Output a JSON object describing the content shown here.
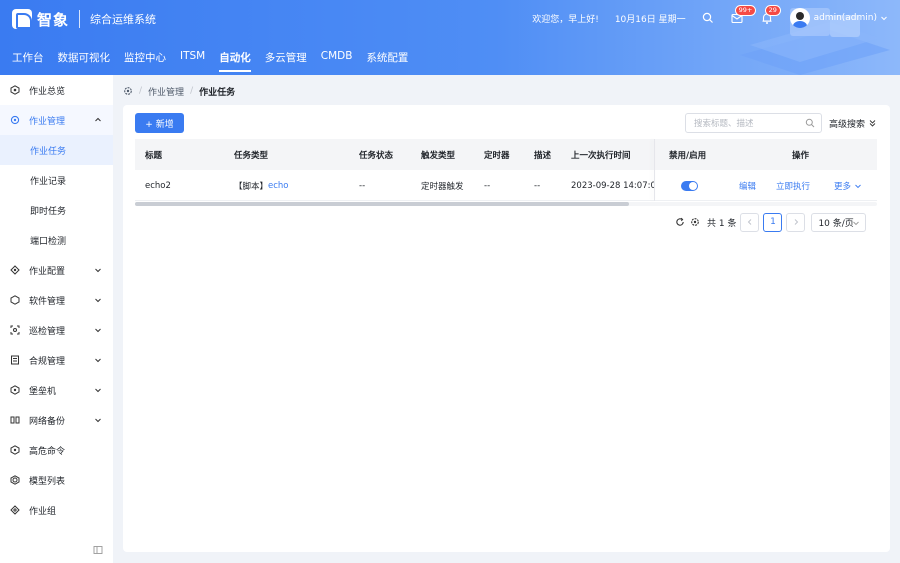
{
  "header": {
    "brand": "智象",
    "system_name": "综合运维系统",
    "greeting": "欢迎您，早上好!",
    "date": "10月16日 星期一",
    "mail_badge": "99+",
    "bell_badge": "29",
    "user": "admin(admin)"
  },
  "nav": {
    "items": [
      "工作台",
      "数据可视化",
      "监控中心",
      "ITSM",
      "自动化",
      "多云管理",
      "CMDB",
      "系统配置"
    ],
    "active": "自动化"
  },
  "sidebar": {
    "items": [
      {
        "label": "作业总览",
        "icon": "overview-icon"
      },
      {
        "label": "作业管理",
        "icon": "gear-icon",
        "open": true
      },
      {
        "label": "作业配置",
        "icon": "config-icon"
      },
      {
        "label": "软件管理",
        "icon": "software-icon"
      },
      {
        "label": "巡检管理",
        "icon": "inspect-icon"
      },
      {
        "label": "合规管理",
        "icon": "compliance-icon"
      },
      {
        "label": "堡垒机",
        "icon": "bastion-icon"
      },
      {
        "label": "网络备份",
        "icon": "backup-icon"
      },
      {
        "label": "高危命令",
        "icon": "danger-icon"
      },
      {
        "label": "模型列表",
        "icon": "model-icon"
      },
      {
        "label": "作业组",
        "icon": "group-icon"
      }
    ],
    "sub_items": [
      "作业任务",
      "作业记录",
      "即时任务",
      "端口检测"
    ]
  },
  "breadcrumb": {
    "parent": "作业管理",
    "current": "作业任务"
  },
  "toolbar": {
    "new_label": "+ 新增",
    "search_placeholder": "搜索标题、描述",
    "advanced_search": "高级搜索"
  },
  "table": {
    "columns": [
      "标题",
      "任务类型",
      "任务状态",
      "触发类型",
      "定时器",
      "描述",
      "上一次执行时间",
      "禁用/启用",
      "操作"
    ],
    "rows": [
      {
        "title": "echo2",
        "type_prefix": "【脚本】",
        "type_link": "echo",
        "status": "--",
        "trigger": "定时器触发",
        "timer": "--",
        "desc": "--",
        "last_run": "2023-09-28 14:07:0",
        "enabled": true,
        "actions": [
          "编辑",
          "立即执行",
          "更多"
        ]
      }
    ]
  },
  "pagination": {
    "total": "共 1 条",
    "current_page": "1",
    "page_size": "10 条/页"
  }
}
